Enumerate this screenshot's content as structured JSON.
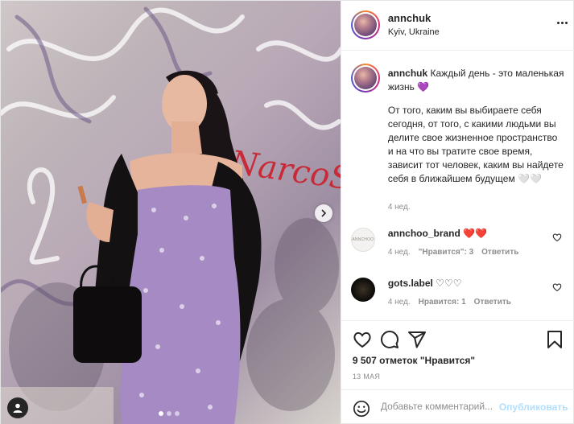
{
  "post": {
    "carousel": {
      "slides": 3,
      "active_slide": 1
    }
  },
  "header": {
    "username": "annchuk",
    "location": "Kyiv, Ukraine"
  },
  "caption": {
    "username": "annchuk",
    "title": "Каждый день - это маленькая жизнь 💜",
    "body": "От того, каким вы выбираете себя сегодня, от того, с какими людьми вы делите свое жизненное пространство и на что вы тратите свое время, зависит тот человек, каким вы найдете себя в ближайшем будущем 🤍🤍",
    "time": "4 нед."
  },
  "comments": [
    {
      "username": "annchoo_brand",
      "text": "❤️❤️",
      "time": "4 нед.",
      "likes": "\"Нравится\": 3",
      "reply": "Ответить",
      "avatar_text": "ANNCHOO"
    },
    {
      "username": "gots.label",
      "text": "♡♡♡",
      "time": "4 нед.",
      "likes": "Нравится: 1",
      "reply": "Ответить"
    }
  ],
  "actions": {
    "likes_text": "9 507 отметок \"Нравится\"",
    "date": "13 МАЯ"
  },
  "comment_box": {
    "placeholder": "Добавьте комментарий...",
    "publish_label": "Опубликовать"
  },
  "icons": {
    "more": "more-options-icon",
    "next": "chevron-right-icon",
    "tag": "user-tag-icon",
    "like": "heart-icon",
    "comment": "comment-icon",
    "share": "paper-plane-icon",
    "save": "bookmark-icon",
    "emoji": "emoji-icon"
  },
  "colors": {
    "text": "#262626",
    "muted": "#8e8e8e",
    "publish_disabled": "#b2dffc",
    "border": "#efefef"
  }
}
